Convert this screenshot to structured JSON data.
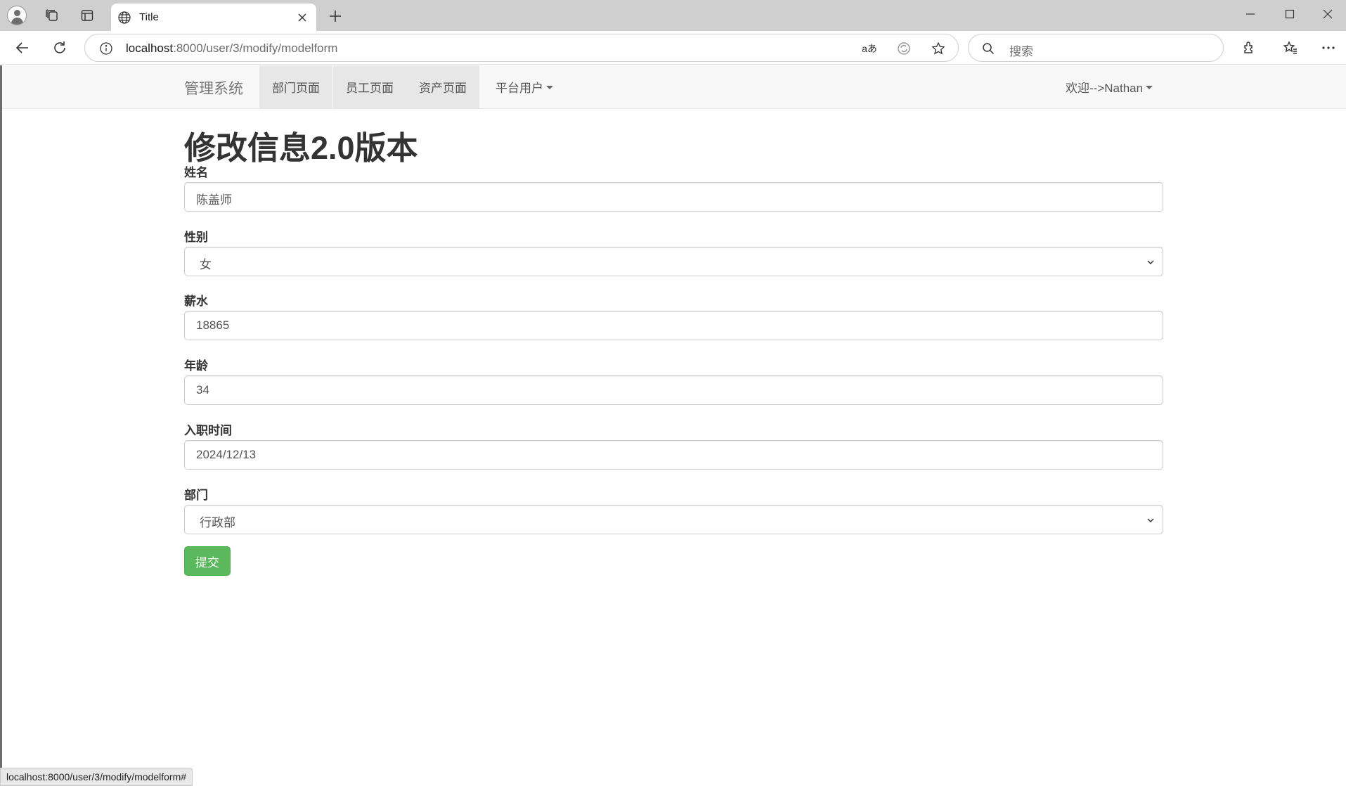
{
  "browser": {
    "tab_title": "Title",
    "url_host": "localhost",
    "url_path": ":8000/user/3/modify/modelform",
    "read_aloud_label": "aあ",
    "search_placeholder": "搜索",
    "status_url": "localhost:8000/user/3/modify/modelform#"
  },
  "navbar": {
    "brand": "管理系统",
    "items": [
      {
        "label": "部门页面"
      },
      {
        "label": "员工页面"
      },
      {
        "label": "资产页面"
      },
      {
        "label": "平台用户"
      }
    ],
    "welcome": "欢迎-->Nathan"
  },
  "form": {
    "title": "修改信息2.0版本",
    "fields": [
      {
        "label": "姓名",
        "value": "陈盖师"
      },
      {
        "label": "性别",
        "value": "女"
      },
      {
        "label": "薪水",
        "value": "18865"
      },
      {
        "label": "年龄",
        "value": "34"
      },
      {
        "label": "入职时间",
        "value": "2024/12/13"
      },
      {
        "label": "部门",
        "value": "行政部"
      }
    ],
    "submit_label": "提交"
  },
  "colors": {
    "accent_success": "#5cb85c",
    "navbar_bg": "#f8f8f8",
    "nav_active_bg": "#e7e7e7"
  }
}
